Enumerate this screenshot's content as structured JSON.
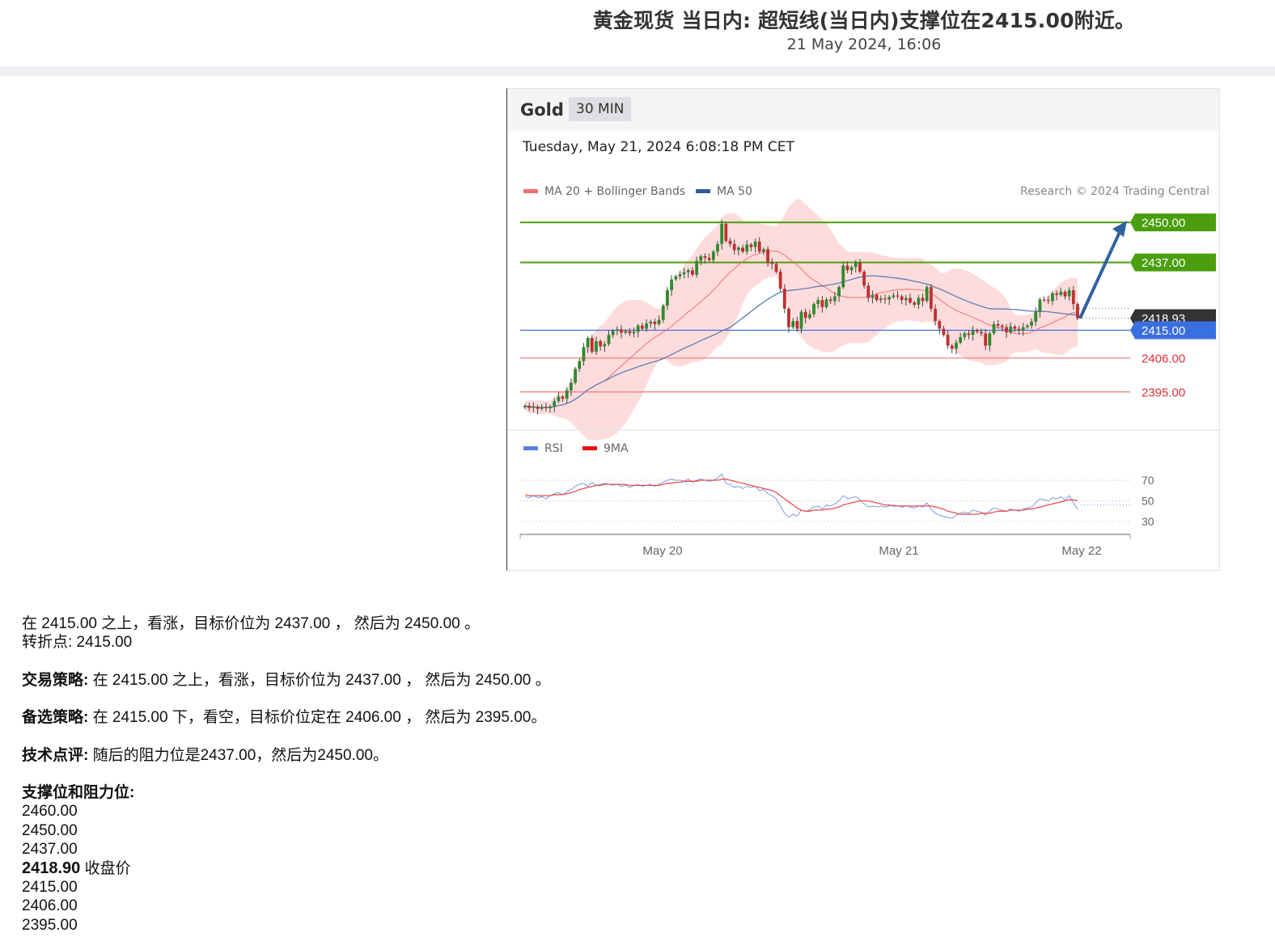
{
  "header": {
    "title": "黄金现货 当日内: 超短线(当日内)支撑位在2415.00附近。",
    "date": "21 May 2024, 16:06"
  },
  "chart_header": {
    "instrument": "Gold",
    "timeframe": "30 MIN",
    "timestamp": "Tuesday, May 21, 2024 6:08:18 PM CET",
    "credit": "Research © 2024 Trading Central"
  },
  "colors": {
    "resistance": "#4a9e0f",
    "pivot": "#3a6fe0",
    "support": "#f08080",
    "support_text": "#e0303a",
    "ma20": "#f07070",
    "ma50": "#5b7fb8",
    "bands": "#ffd0d0",
    "arrow": "#2f62a0",
    "rsi": "#7b98e0",
    "rsi_ma": "#e85050",
    "candle_up": "#2e8b2e",
    "candle_down": "#c03030",
    "last_price_tag": "#333333"
  },
  "chart_data": {
    "type": "candlestick",
    "legend": [
      "MA 20 + Bollinger Bands",
      "MA 50"
    ],
    "y_range": [
      2380,
      2455
    ],
    "x_ticks": [
      "May 20",
      "May 21",
      "May 22"
    ],
    "levels": [
      {
        "value": "2450.00",
        "kind": "resistance"
      },
      {
        "value": "2437.00",
        "kind": "resistance"
      },
      {
        "value": "2418.93",
        "kind": "last"
      },
      {
        "value": "2415.00",
        "kind": "pivot"
      },
      {
        "value": "2406.00",
        "kind": "support"
      },
      {
        "value": "2395.00",
        "kind": "support"
      }
    ],
    "closes": [
      2390.5,
      2389.8,
      2390.2,
      2389.5,
      2390.1,
      2389.7,
      2390.3,
      2392.0,
      2393.5,
      2392.8,
      2395.5,
      2398.0,
      2402.5,
      2405.0,
      2409.5,
      2412.5,
      2408.0,
      2411.5,
      2409.8,
      2410.5,
      2413.5,
      2414.8,
      2415.3,
      2414.2,
      2414.7,
      2414.0,
      2414.5,
      2416.5,
      2415.5,
      2417.2,
      2417.8,
      2417.0,
      2418.4,
      2423.0,
      2428.0,
      2431.5,
      2432.5,
      2433.2,
      2433.8,
      2434.5,
      2433.0,
      2437.5,
      2439.0,
      2438.5,
      2437.8,
      2440.5,
      2443.0,
      2449.5,
      2444.0,
      2443.0,
      2441.0,
      2441.8,
      2440.5,
      2442.8,
      2442.0,
      2443.8,
      2440.5,
      2441.3,
      2437.0,
      2436.5,
      2434.0,
      2428.5,
      2422.0,
      2416.0,
      2418.0,
      2415.5,
      2421.0,
      2419.0,
      2420.2,
      2423.5,
      2424.8,
      2422.5,
      2425.0,
      2424.5,
      2426.0,
      2429.0,
      2436.0,
      2434.5,
      2435.5,
      2436.8,
      2434.0,
      2429.5,
      2425.5,
      2426.5,
      2424.8,
      2425.3,
      2425.0,
      2425.8,
      2426.3,
      2426.0,
      2424.8,
      2425.5,
      2424.0,
      2423.3,
      2425.5,
      2424.5,
      2429.0,
      2422.0,
      2418.0,
      2415.5,
      2413.5,
      2410.0,
      2409.0,
      2411.0,
      2412.8,
      2414.0,
      2413.5,
      2415.0,
      2414.5,
      2414.0,
      2410.0,
      2414.0,
      2417.0,
      2416.5,
      2416.0,
      2414.3,
      2416.2,
      2415.5,
      2415.0,
      2416.0,
      2416.5,
      2417.8,
      2421.0,
      2425.0,
      2424.8,
      2424.5,
      2427.0,
      2426.5,
      2427.5,
      2426.0,
      2428.0,
      2423.5,
      2418.9
    ],
    "rsi_levels": [
      "70",
      "50",
      "30"
    ],
    "rsi_legend": [
      "RSI",
      "9MA"
    ],
    "rsi": [
      54,
      53,
      55,
      53,
      54,
      52,
      55,
      57,
      58,
      56,
      59,
      61,
      64,
      66,
      67,
      64,
      68,
      65,
      66,
      67,
      66,
      65,
      66,
      64,
      65,
      63,
      65,
      66,
      64,
      65,
      66,
      64,
      66,
      68,
      70,
      71,
      70,
      70,
      69,
      71,
      68,
      70,
      71,
      70,
      69,
      70,
      72,
      76,
      67,
      66,
      63,
      64,
      62,
      64,
      63,
      64,
      60,
      61,
      57,
      55,
      52,
      45,
      38,
      34,
      37,
      35,
      41,
      40,
      41,
      44,
      45,
      42,
      46,
      45,
      47,
      50,
      55,
      52,
      53,
      54,
      51,
      47,
      44,
      45,
      44,
      45,
      44,
      45,
      46,
      45,
      44,
      45,
      44,
      43,
      45,
      44,
      48,
      42,
      38,
      36,
      35,
      34,
      33,
      36,
      38,
      39,
      38,
      41,
      40,
      39,
      36,
      40,
      43,
      42,
      41,
      40,
      42,
      41,
      40,
      42,
      43,
      44,
      48,
      52,
      51,
      50,
      53,
      52,
      54,
      51,
      55,
      48,
      42
    ],
    "rsi_ma": [
      56,
      55,
      55,
      55,
      55,
      55,
      55,
      56,
      56,
      56,
      57,
      58,
      59,
      61,
      62,
      63,
      64,
      65,
      65,
      66,
      66,
      66,
      66,
      66,
      66,
      65,
      65,
      65,
      65,
      65,
      65,
      65,
      65,
      66,
      67,
      67,
      68,
      68,
      69,
      69,
      69,
      69,
      70,
      70,
      70,
      70,
      70,
      71,
      71,
      70,
      69,
      68,
      67,
      66,
      65,
      64,
      63,
      62,
      61,
      60,
      58,
      55,
      52,
      49,
      46,
      43,
      41,
      40,
      40,
      41,
      41,
      41,
      42,
      42,
      43,
      44,
      46,
      47,
      48,
      49,
      50,
      50,
      50,
      49,
      48,
      47,
      46,
      46,
      45,
      45,
      45,
      45,
      45,
      45,
      45,
      45,
      45,
      45,
      44,
      43,
      42,
      40,
      39,
      38,
      37,
      37,
      37,
      37,
      37,
      38,
      38,
      38,
      39,
      40,
      40,
      40,
      41,
      41,
      41,
      41,
      42,
      42,
      43,
      44,
      45,
      46,
      47,
      48,
      49,
      50,
      51,
      51,
      50
    ]
  },
  "analysis": {
    "summary_line1": "在 2415.00 之上，看涨，目标价位为 2437.00 ， 然后为 2450.00 。",
    "pivot_line": "转折点: 2415.00",
    "strategy_label": "交易策略:",
    "strategy_text": "在 2415.00 之上，看涨，目标价位为 2437.00 ， 然后为 2450.00 。",
    "alt_label": "备选策略:",
    "alt_text": "在 2415.00 下，看空，目标价位定在 2406.00 ， 然后为 2395.00。",
    "comment_label": "技术点评:",
    "comment_text": "随后的阻力位是2437.00，然后为2450.00。",
    "levels_label": "支撑位和阻力位:",
    "levels": [
      "2460.00",
      "2450.00",
      "2437.00"
    ],
    "last_value": "2418.90",
    "last_label": "收盘价",
    "levels_below": [
      "2415.00",
      "2406.00",
      "2395.00"
    ]
  }
}
